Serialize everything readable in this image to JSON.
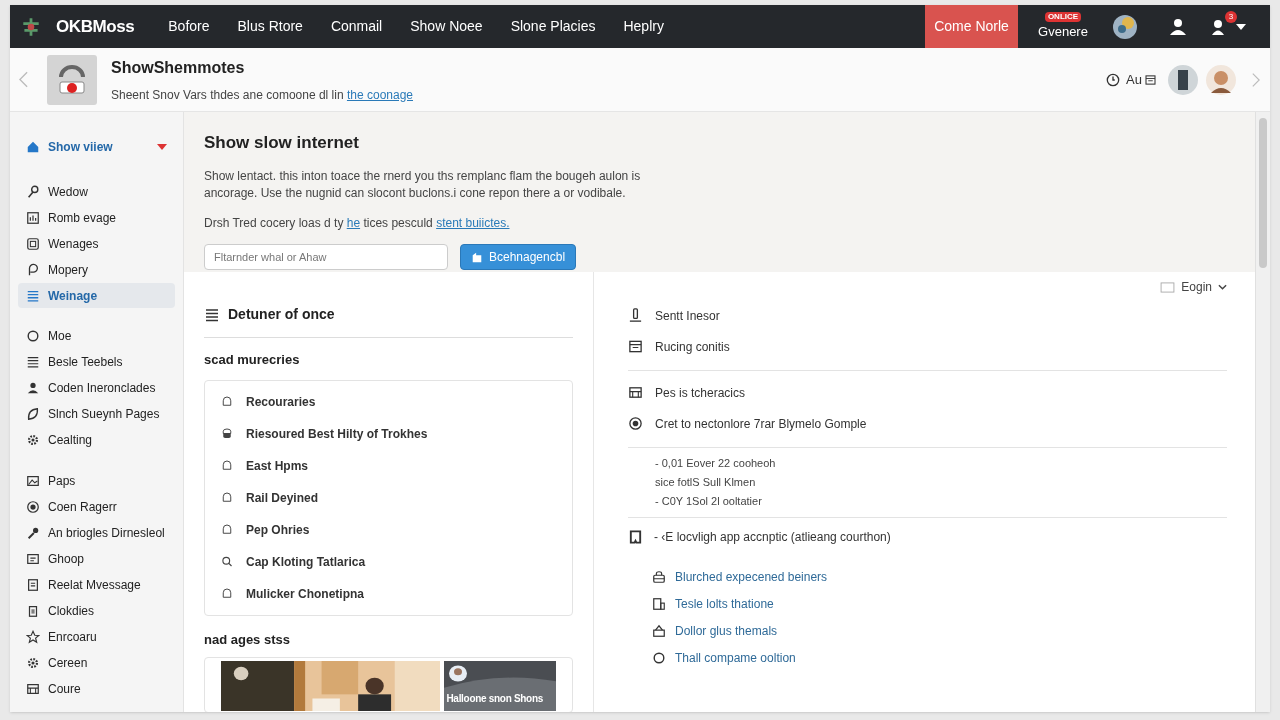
{
  "nav": {
    "logo": "OKBMoss",
    "items": [
      "Bofore",
      "Blus Rtore",
      "Conmail",
      "Show Noee",
      "Slone Placies",
      "Heplry"
    ],
    "cta": "Come Norle",
    "badge": "ONLICE",
    "user_label": "Gvenere",
    "notification_count": "3"
  },
  "header": {
    "title": "ShowShemmotes",
    "subtitle": [
      {
        "text": "Sheent Snov Vars thdes ane comoone dl lin "
      },
      {
        "text": "the coonage",
        "kind": "link"
      }
    ],
    "right_label": "Au"
  },
  "sidebar": {
    "groups": [
      [
        {
          "label": "Show viiew",
          "selected": false,
          "expanded": true
        }
      ],
      [
        {
          "label": "Wedow",
          "selected": false
        },
        {
          "label": "Romb evage",
          "selected": false
        },
        {
          "label": "Wenages",
          "selected": false
        },
        {
          "label": "Mopery",
          "selected": false
        },
        {
          "label": "Weinage",
          "selected": true
        }
      ],
      [
        {
          "label": "Moe",
          "selected": false
        },
        {
          "label": "Besle Teebels",
          "selected": false
        },
        {
          "label": "Coden Ineronclades",
          "selected": false
        },
        {
          "label": "Slnch Sueynh Pages",
          "selected": false
        },
        {
          "label": "Cealting",
          "selected": false
        }
      ],
      [
        {
          "label": "Paps",
          "selected": false
        },
        {
          "label": "Coen Ragerr",
          "selected": false
        },
        {
          "label": "An briogles Dirnesleol",
          "selected": false
        },
        {
          "label": "Ghoop",
          "selected": false
        },
        {
          "label": "Reelat Mvessage",
          "selected": false
        },
        {
          "label": "Clokdies",
          "selected": false
        },
        {
          "label": "Enrcoaru",
          "selected": false
        },
        {
          "label": "Cereen",
          "selected": false
        },
        {
          "label": "Coure",
          "selected": false
        }
      ]
    ]
  },
  "intro": {
    "title": "Show slow internet",
    "paragraph": "Show lentact. this inton toace the rnerd you ths remplanc flam the bougeh aulon is ancorage. Use the nugnid can slocont buclons.i cone repon there a or vodibale.",
    "note": [
      {
        "text": "Drsh Tred cocery loas d ty "
      },
      {
        "text": "he",
        "kind": "link"
      },
      {
        "text": " tices pesculd "
      },
      {
        "text": "stent buiictes.",
        "kind": "link"
      }
    ],
    "search_placeholder": "Fltarnder whal or Ahaw",
    "button": "Bcehnagencbl"
  },
  "left_panel": {
    "heading": "Detuner of once",
    "section": "scad murecries",
    "items": [
      "Recouraries",
      "Riesoured Best Hilty of Trokhes",
      "East Hpms",
      "Rail Deyined",
      "Pep Ohries",
      "Cap Kloting Tatlarica",
      "Mulicker Chonetipna"
    ],
    "gallery_title": "nad ages stss",
    "tiles": [
      {
        "kind": "picture"
      },
      {
        "kind": "picture",
        "caption": "Halloone snon Shons"
      }
    ]
  },
  "right_panel": {
    "dropdown": "Eogin",
    "groups": [
      [
        "Sentt Inesor",
        "Rucing conitis"
      ],
      [
        "Pes is tcheracics",
        "Cret to nectonlore 7rar Blymelo Gomple"
      ]
    ],
    "notes": [
      "- 0,01 Eover 22 cooheoh",
      "sice fotlS Sull Klmen",
      "- C0Y 1Sol 2l ooltatier"
    ],
    "callout": "- ‹E locvligh app accnptic (atlieang courthon)",
    "links": [
      "Blurched expecened beiners",
      "Tesle lolts thatione",
      "Dollor glus themals",
      "Thall compame ooltion"
    ]
  }
}
